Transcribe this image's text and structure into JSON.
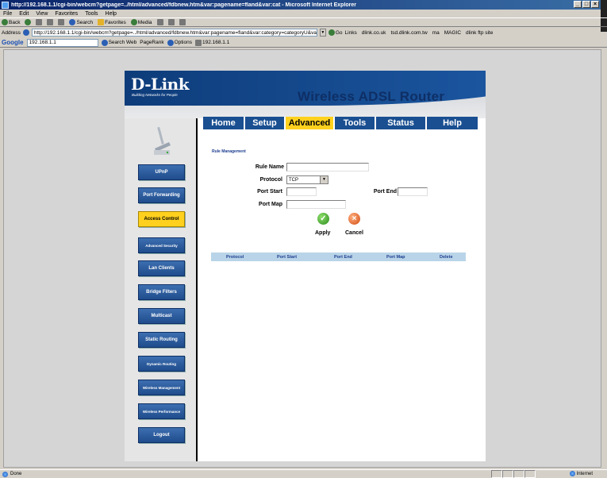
{
  "browser": {
    "window_title": "http://192.168.1.1/cgi-bin/webcm?getpage=../html/advanced/fdbnew.htm&var:pagename=fland&var:cat - Microsoft Internet Explorer",
    "menu": [
      "File",
      "Edit",
      "View",
      "Favorites",
      "Tools",
      "Help"
    ],
    "toolbar": {
      "back": "Back",
      "search": "Search",
      "favorites": "Favorites",
      "media": "Media"
    },
    "address_label": "Address",
    "address_value": "http://192.168.1.1/cgi-bin/webcm?getpage=../html/advanced/fdbnew.htm&var:pagename=fland&var:category=categoryU&var",
    "go": "Go",
    "links_label": "Links",
    "links": [
      "dlink.co.uk",
      "tsd.dlink.com.tw",
      "ma",
      "MAGIC",
      "dlink ftp site"
    ],
    "google": {
      "logo": "Google",
      "search_value": "192.168.1.1",
      "search_web": "Search Web",
      "pagerank": "PageRank",
      "options": "Options",
      "last_query": "192.168.1.1"
    },
    "status_left": "Done",
    "status_zone": "Internet"
  },
  "router": {
    "logo": "D-Link",
    "tagline": "Building Networks for People",
    "product": "Wireless ADSL Router",
    "tabs": [
      {
        "label": "Home",
        "active": false
      },
      {
        "label": "Setup",
        "active": false
      },
      {
        "label": "Advanced",
        "active": true
      },
      {
        "label": "Tools",
        "active": false
      },
      {
        "label": "Status",
        "active": false
      },
      {
        "label": "Help",
        "active": false
      }
    ],
    "sidebar": [
      {
        "label": "UPnP",
        "active": false
      },
      {
        "label": "Port Forwarding",
        "active": false
      },
      {
        "label": "Access Control",
        "active": true
      },
      {
        "label": "Advanced Security",
        "active": false
      },
      {
        "label": "Lan Clients",
        "active": false
      },
      {
        "label": "Bridge Filters",
        "active": false
      },
      {
        "label": "Multicast",
        "active": false
      },
      {
        "label": "Static Routing",
        "active": false
      },
      {
        "label": "Dynamic Routing",
        "active": false
      },
      {
        "label": "Wireless Management",
        "active": false
      },
      {
        "label": "Wireless Performance",
        "active": false
      },
      {
        "label": "Logout",
        "active": false
      }
    ],
    "form": {
      "section_title": "Rule Management",
      "rule_name_label": "Rule Name",
      "rule_name_value": "",
      "protocol_label": "Protocol",
      "protocol_value": "TCP",
      "port_start_label": "Port Start",
      "port_start_value": "",
      "port_end_label": "Port End",
      "port_end_value": "",
      "port_map_label": "Port Map",
      "port_map_value": "",
      "apply": "Apply",
      "cancel": "Cancel"
    },
    "table": {
      "columns": [
        "Protocol",
        "Port Start",
        "Port End",
        "Port Map",
        "Delete"
      ],
      "rows": []
    }
  },
  "colors": {
    "dlink_blue": "#1a4f91",
    "active_yellow": "#ffd11e",
    "title_navy": "#0e2f66",
    "table_header": "#b9d4e8"
  }
}
